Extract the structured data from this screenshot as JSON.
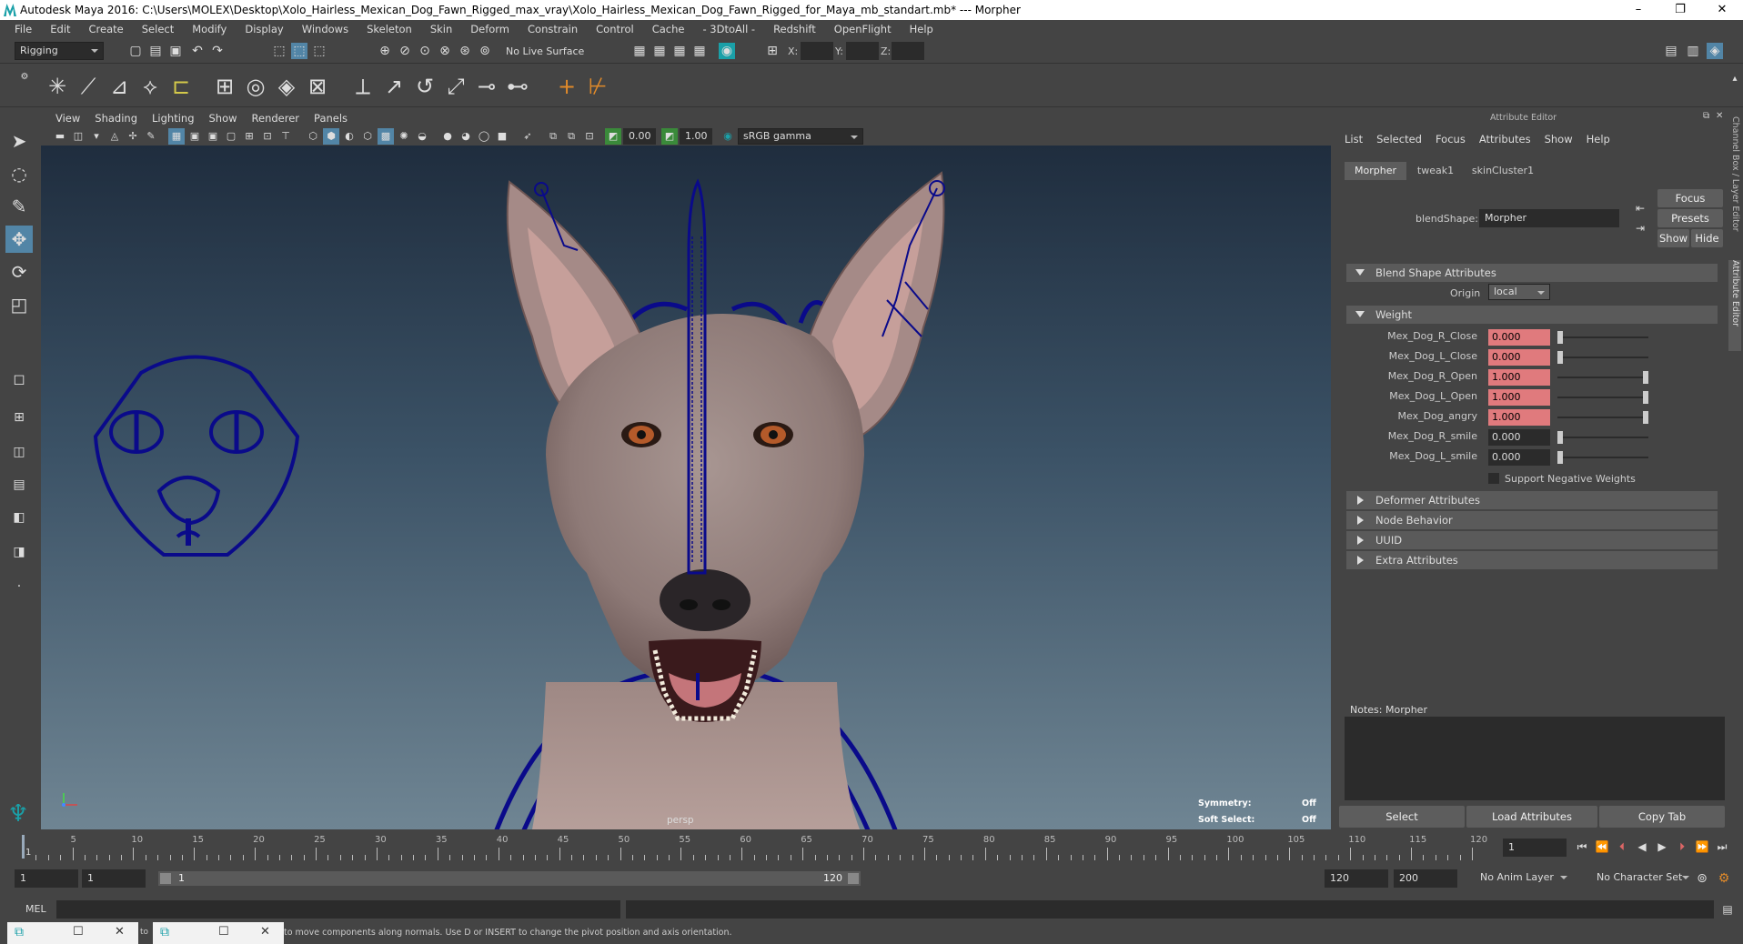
{
  "window": {
    "title": "Autodesk Maya 2016: C:\\Users\\MOLEX\\Desktop\\Xolo_Hairless_Mexican_Dog_Fawn_Rigged_max_vray\\Xolo_Hairless_Mexican_Dog_Fawn_Rigged_for_Maya_mb_standart.mb*  ---  Morpher",
    "min": "–",
    "max": "❐",
    "close": "✕"
  },
  "menus": [
    "File",
    "Edit",
    "Create",
    "Select",
    "Modify",
    "Display",
    "Windows",
    "Skeleton",
    "Skin",
    "Deform",
    "Constrain",
    "Control",
    "Cache",
    "- 3DtoAll -",
    "Redshift",
    "OpenFlight",
    "Help"
  ],
  "status": {
    "menuset": "Rigging",
    "live_surface": "No Live Surface",
    "x_label": "X:",
    "y_label": "Y:",
    "z_label": "Z:"
  },
  "panel": {
    "menus": [
      "View",
      "Shading",
      "Lighting",
      "Show",
      "Renderer",
      "Panels"
    ],
    "near": "0.00",
    "far": "1.00",
    "colorspace": "sRGB gamma",
    "camera": "persp",
    "symmetry_label": "Symmetry:",
    "symmetry_value": "Off",
    "softselect_label": "Soft Select:",
    "softselect_value": "Off"
  },
  "ae": {
    "title": "Attribute Editor",
    "menus": [
      "List",
      "Selected",
      "Focus",
      "Attributes",
      "Show",
      "Help"
    ],
    "tabs": [
      "Morpher",
      "tweak1",
      "skinCluster1"
    ],
    "blendshape_label": "blendShape:",
    "blendshape_value": "Morpher",
    "focus": "Focus",
    "presets": "Presets",
    "show": "Show",
    "hide": "Hide",
    "sec_blend": "Blend Shape Attributes",
    "origin_label": "Origin",
    "origin_value": "local",
    "sec_weight": "Weight",
    "weights": [
      {
        "name": "Mex_Dog_R_Close",
        "value": "0.000",
        "level": 0,
        "keyed": true
      },
      {
        "name": "Mex_Dog_L_Close",
        "value": "0.000",
        "level": 0,
        "keyed": true
      },
      {
        "name": "Mex_Dog_R_Open",
        "value": "1.000",
        "level": 1,
        "keyed": true
      },
      {
        "name": "Mex_Dog_L_Open",
        "value": "1.000",
        "level": 1,
        "keyed": true
      },
      {
        "name": "Mex_Dog_angry",
        "value": "1.000",
        "level": 1,
        "keyed": true
      },
      {
        "name": "Mex_Dog_R_smile",
        "value": "0.000",
        "level": 0,
        "keyed": false
      },
      {
        "name": "Mex_Dog_L_smile",
        "value": "0.000",
        "level": 0,
        "keyed": false
      }
    ],
    "support_neg": "Support Negative Weights",
    "collapsed": [
      "Deformer Attributes",
      "Node Behavior",
      "UUID",
      "Extra Attributes"
    ],
    "notes": "Notes:  Morpher",
    "select": "Select",
    "load": "Load Attributes",
    "copy": "Copy Tab"
  },
  "side_tabs": [
    "Channel Box / Layer Editor",
    "Attribute Editor"
  ],
  "time": {
    "ticks": [
      "5",
      "10",
      "15",
      "20",
      "25",
      "30",
      "35",
      "40",
      "45",
      "50",
      "55",
      "60",
      "65",
      "70",
      "75",
      "80",
      "85",
      "90",
      "95",
      "100",
      "105",
      "110",
      "115",
      "120"
    ],
    "first_tick": "1",
    "current": "1",
    "start": "1",
    "inner_start": "1",
    "range_start": "1",
    "range_end": "120",
    "end": "120",
    "max": "200",
    "anim_layer": "No Anim Layer",
    "char_set": "No Character Set"
  },
  "cmd": {
    "mel": "MEL"
  },
  "help": {
    "to": "to",
    "text": "to move components along normals. Use D or INSERT to change the pivot position and axis orientation."
  },
  "colors": {
    "bg": "#444444",
    "keyed": "#e07a7d",
    "accent": "#1aa0a8",
    "rig": "#0a0a8a"
  }
}
